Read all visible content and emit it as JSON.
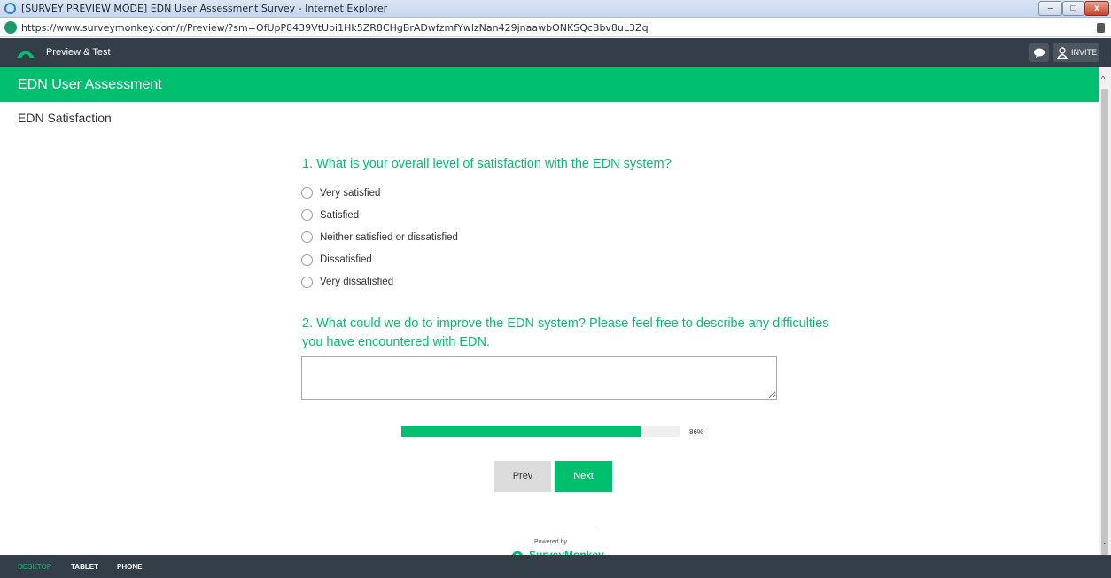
{
  "window": {
    "title": "[SURVEY PREVIEW MODE] EDN User Assessment Survey - Internet Explorer",
    "url": "https://www.surveymonkey.com/r/Preview/?sm=OfUpP8439VtUbi1Hk5ZR8CHgBrADwfzmfYwlzNan429jnaawbONKSQcBbv8uL3Zq",
    "buttons": {
      "minimize": "–",
      "maximize": "□",
      "close": "x"
    }
  },
  "toolbar": {
    "title": "Preview & Test",
    "chat_icon": "chat-bubble-icon",
    "invite_label": "INVITE"
  },
  "survey": {
    "title": "EDN User Assessment",
    "page_title": "EDN Satisfaction",
    "questions": [
      {
        "text": "1. What is your overall level of satisfaction with the EDN system?",
        "options": [
          "Very satisfied",
          "Satisfied",
          "Neither satisfied or dissatisfied",
          "Dissatisfied",
          "Very dissatisfied"
        ]
      },
      {
        "text": "2. What could we do to improve the EDN system? Please feel free to describe any difficulties you have encountered with EDN.",
        "answer_value": ""
      }
    ],
    "progress": {
      "percent": 86,
      "label": "86%"
    },
    "prev_label": "Prev",
    "next_label": "Next",
    "powered_by": "Powered by",
    "brand": "SurveyMonkey"
  },
  "device_bar": {
    "desktop": "DESKTOP",
    "tablet": "TABLET",
    "phone": "PHONE"
  },
  "colors": {
    "accent": "#00bf6f",
    "dark": "#333e48"
  }
}
